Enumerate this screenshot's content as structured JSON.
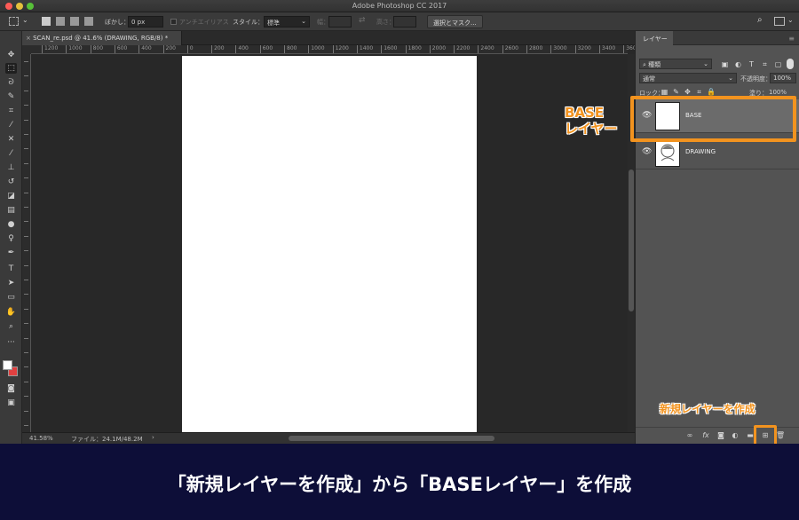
{
  "window": {
    "title": "Adobe Photoshop CC 2017"
  },
  "options_bar": {
    "feather_label": "ぼかし：",
    "feather_value": "0 px",
    "antialias_label": "アンチエイリアス",
    "style_label": "スタイル：",
    "style_value": "標準",
    "width_label": "幅：",
    "height_label": "高さ：",
    "select_mask_button": "選択とマスク..."
  },
  "document": {
    "tab_title": "SCAN_re.psd @ 41.6% (DRAWING, RGB/8) *",
    "ruler_ticks": [
      "1200",
      "1000",
      "800",
      "600",
      "400",
      "200",
      "0",
      "200",
      "400",
      "600",
      "800",
      "1000",
      "1200",
      "1400",
      "1600",
      "1800",
      "2000",
      "2200",
      "2400",
      "2600",
      "2800",
      "3000",
      "3200",
      "3400",
      "3600"
    ]
  },
  "status_bar": {
    "zoom": "41.58%",
    "file_info": "ファイル：24.1M/48.2M"
  },
  "layers_panel": {
    "tab_label": "レイヤー",
    "filter_kind": "種類",
    "blend_mode": "通常",
    "opacity_label": "不透明度：",
    "opacity_value": "100%",
    "lock_label": "ロック：",
    "fill_label": "塗り：",
    "fill_value": "100%",
    "layers": [
      {
        "name": "BASE",
        "selected": true
      },
      {
        "name": "DRAWING",
        "selected": false
      }
    ],
    "footer_icons": [
      "link-icon",
      "fx-icon",
      "mask-icon",
      "adjustment-icon",
      "folder-icon",
      "new-layer-icon",
      "trash-icon"
    ]
  },
  "annotations": {
    "base_layer_label_line1": "BASE",
    "base_layer_label_line2": "レイヤー",
    "new_layer_label": "新規レイヤーを作成",
    "highlight_color": "#f2931f"
  },
  "caption": {
    "text": "「新規レイヤーを作成」から「BASEレイヤー」を作成",
    "background": "#0d0e38"
  }
}
